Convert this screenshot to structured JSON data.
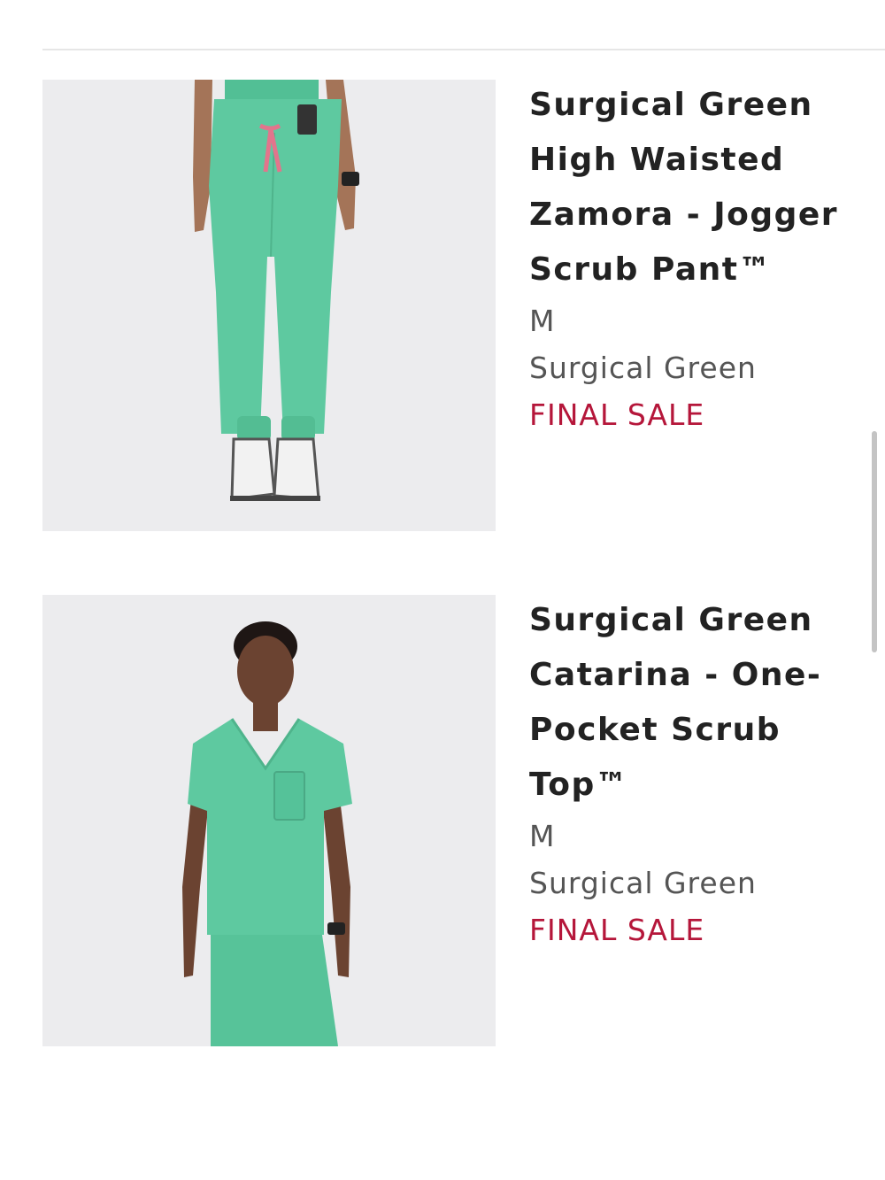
{
  "products": [
    {
      "title": "Surgical Green High Waisted Zamora - Jogger Scrub Pant™",
      "size": "M",
      "color": "Surgical Green",
      "status": "FINAL SALE"
    },
    {
      "title": "Surgical Green Catarina - One-Pocket Scrub Top™",
      "size": "M",
      "color": "Surgical Green",
      "status": "FINAL SALE"
    }
  ],
  "colors": {
    "scrub": "#5ec9a0",
    "sale": "#b5163a",
    "image_bg": "#ececee"
  }
}
